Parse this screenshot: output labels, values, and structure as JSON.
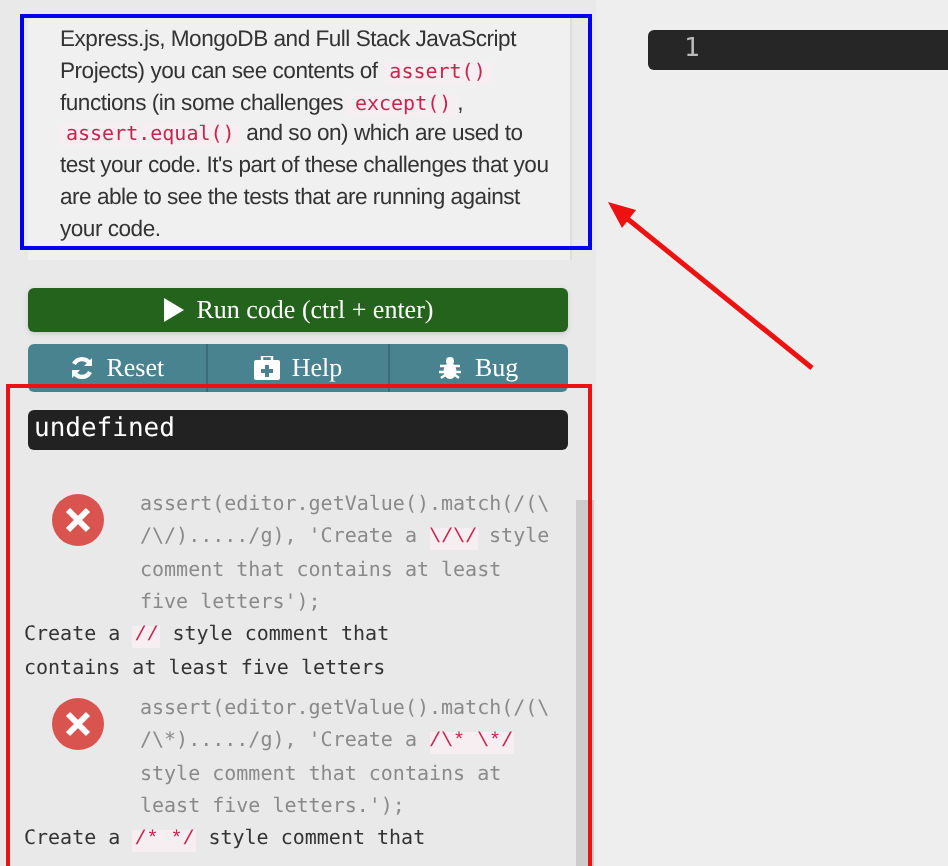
{
  "description": [
    {
      "kind": "text",
      "text": "Express.js, MongoDB and Full Stack JavaScript Projects) you can see contents of "
    },
    {
      "kind": "code",
      "text": "assert()"
    },
    {
      "kind": "text",
      "text": " functions (in some challenges "
    },
    {
      "kind": "code",
      "text": "except()"
    },
    {
      "kind": "text",
      "text": ", "
    },
    {
      "kind": "code",
      "text": "assert.equal()"
    },
    {
      "kind": "text",
      "text": " and so on) which are used to test your code. It's part of these challenges that you are able to see the tests that are running against your code."
    }
  ],
  "run_button": {
    "label": "Run code (ctrl + enter)"
  },
  "tool_buttons": [
    {
      "label": "Reset"
    },
    {
      "label": "Help"
    },
    {
      "label": "Bug"
    }
  ],
  "output": "undefined",
  "tests": [
    {
      "passed": false,
      "assertion": [
        {
          "kind": "text",
          "text": "assert(editor.getValue().match(/(\\/\\/)...../g), 'Create a "
        },
        {
          "kind": "code",
          "text": "\\/\\/"
        },
        {
          "kind": "text",
          "text": " style comment that contains at least five letters');"
        }
      ],
      "message": [
        {
          "kind": "text",
          "text": "Create a "
        },
        {
          "kind": "code",
          "text": "//"
        },
        {
          "kind": "text",
          "text": " style comment that contains at least five letters"
        }
      ]
    },
    {
      "passed": false,
      "assertion": [
        {
          "kind": "text",
          "text": "assert(editor.getValue().match(/(\\/\\*)...../g), 'Create a "
        },
        {
          "kind": "code",
          "text": "/\\* \\*/"
        },
        {
          "kind": "text",
          "text": " style comment that contains at least five letters.');"
        }
      ],
      "message": [
        {
          "kind": "text",
          "text": "Create a "
        },
        {
          "kind": "code",
          "text": "/* */"
        },
        {
          "kind": "text",
          "text": " style comment that"
        }
      ]
    }
  ],
  "editor": {
    "line_number": "1"
  },
  "annotations": [
    {
      "kind": "box",
      "color": "#0000ee"
    },
    {
      "kind": "box",
      "color": "#ee1111"
    },
    {
      "kind": "arrow",
      "color": "#ee1111"
    }
  ]
}
